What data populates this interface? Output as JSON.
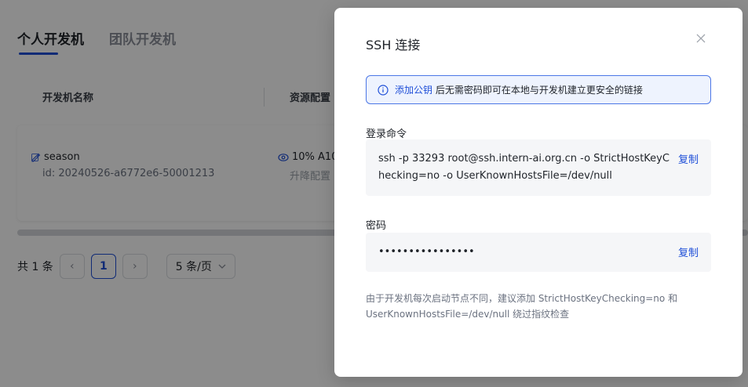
{
  "background": {
    "tabs": [
      {
        "label": "个人开发机"
      },
      {
        "label": "团队开发机"
      }
    ],
    "table": {
      "headers": [
        "开发机名称",
        "资源配置"
      ],
      "row": {
        "name": "season",
        "id": "id: 20240526-a6772e6-50001213",
        "resource": "10% A10",
        "upgrade": "升降配置"
      }
    },
    "pagination": {
      "total": "共 1 条",
      "prev_icon": "‹",
      "current_page": "1",
      "next_icon": "›",
      "page_size": "5 条/页"
    }
  },
  "modal": {
    "title": "SSH 连接",
    "alert": {
      "link_text": "添加公钥",
      "text": "后无需密码即可在本地与开发机建立更安全的链接"
    },
    "login": {
      "label": "登录命令",
      "command": "ssh -p 33293 root@ssh.intern-ai.org.cn -o StrictHostKeyChecking=no -o UserKnownHostsFile=/dev/null",
      "copy_label": "复制"
    },
    "password": {
      "label": "密码",
      "value": "••••••••••••••••",
      "copy_label": "复制"
    },
    "hint": "由于开发机每次启动节点不同，建议添加 StrictHostKeyChecking=no 和 UserKnownHostsFile=/dev/null 绕过指纹检查"
  },
  "colors": {
    "accent": "#1f4fd8",
    "alert_bg": "#eef3fe",
    "overlay": "rgba(0,0,0,0.45)"
  }
}
